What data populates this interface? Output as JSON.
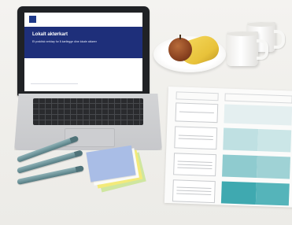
{
  "laptop_screen": {
    "logo_text": "",
    "title": "Lokalt aktørkart",
    "subtitle": "Et praktisk verktøy for å kartlegge dine lokale aktører"
  },
  "matrix_sheet": {
    "rows": 4
  },
  "colors": {
    "screen_hero": "#1e2f7a",
    "teal_light": "#bfe0e2",
    "teal_mid": "#8fcbcf",
    "teal_dark": "#3fa9b0",
    "note_blue": "#a9bde6",
    "note_yellow": "#f3ea7a",
    "note_green": "#cfe6a0",
    "pen": "#6b9298"
  }
}
